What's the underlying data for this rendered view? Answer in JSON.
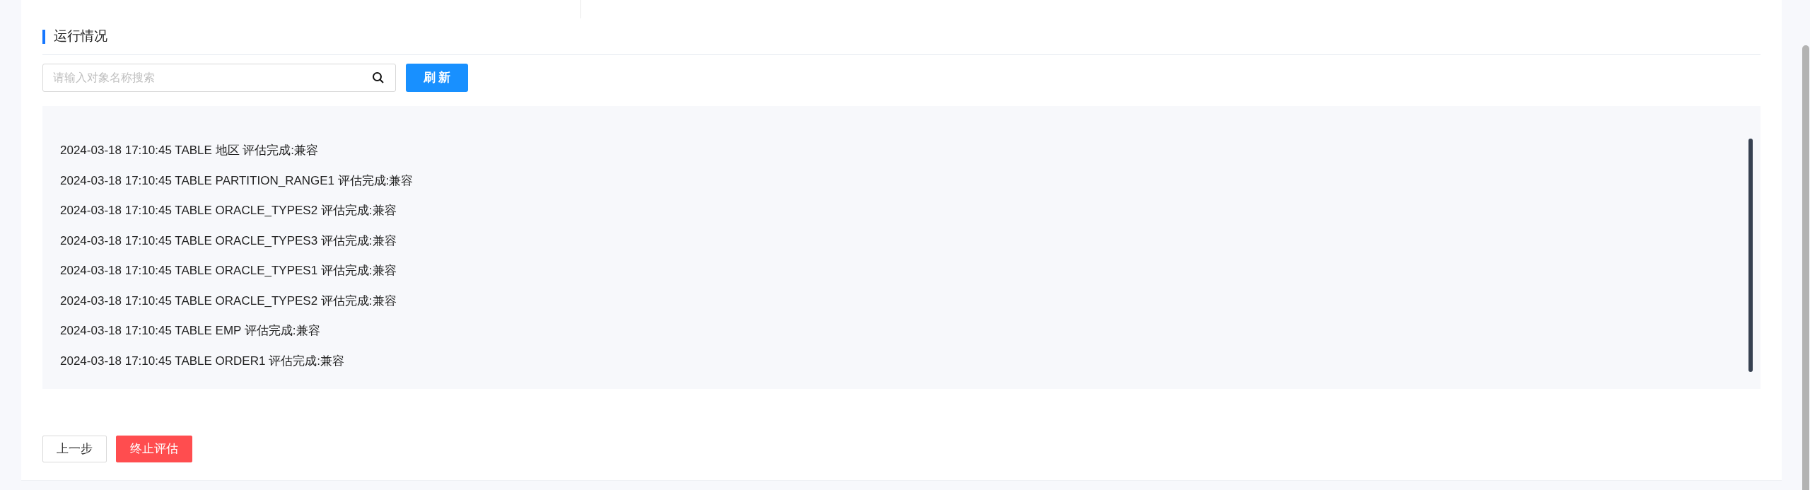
{
  "section": {
    "title": "运行情况"
  },
  "search": {
    "placeholder": "请输入对象名称搜索"
  },
  "refresh_button": "刷 新",
  "log_lines": [
    "2024-03-18 17:10:45 TABLE 地区 评估完成:兼容",
    "2024-03-18 17:10:45 TABLE PARTITION_RANGE1 评估完成:兼容",
    "2024-03-18 17:10:45 TABLE ORACLE_TYPES2 评估完成:兼容",
    "2024-03-18 17:10:45 TABLE ORACLE_TYPES3 评估完成:兼容",
    "2024-03-18 17:10:45 TABLE ORACLE_TYPES1 评估完成:兼容",
    "2024-03-18 17:10:45 TABLE ORACLE_TYPES2 评估完成:兼容",
    "2024-03-18 17:10:45 TABLE EMP 评估完成:兼容",
    "2024-03-18 17:10:45 TABLE ORDER1 评估完成:兼容"
  ],
  "footer_buttons": [
    {
      "label": "上一步",
      "kind": "default"
    },
    {
      "label": "终止评估",
      "kind": "danger"
    }
  ]
}
